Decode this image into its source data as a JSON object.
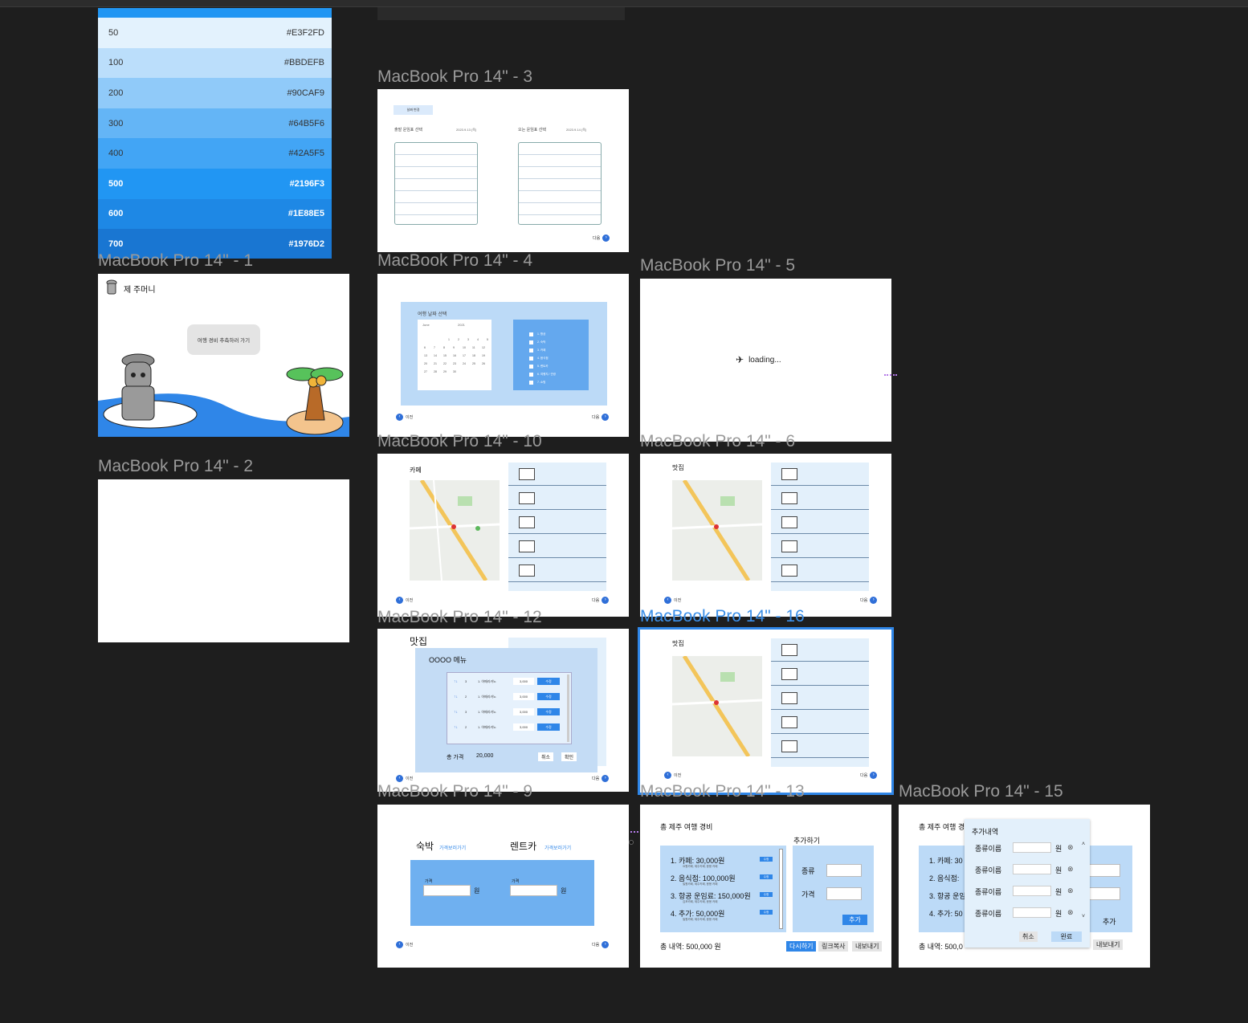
{
  "palette": [
    {
      "shade": "50",
      "hex": "#E3F2FD",
      "bg": "#E3F2FD"
    },
    {
      "shade": "100",
      "hex": "#BBDEFB",
      "bg": "#BBDEFB"
    },
    {
      "shade": "200",
      "hex": "#90CAF9",
      "bg": "#90CAF9"
    },
    {
      "shade": "300",
      "hex": "#64B5F6",
      "bg": "#64B5F6"
    },
    {
      "shade": "400",
      "hex": "#42A5F5",
      "bg": "#42A5F5"
    },
    {
      "shade": "500",
      "hex": "#2196F3",
      "bg": "#2196F3"
    },
    {
      "shade": "600",
      "hex": "#1E88E5",
      "bg": "#1E88E5"
    },
    {
      "shade": "700",
      "hex": "#1976D2",
      "bg": "#1976D2"
    }
  ],
  "frames": {
    "f1": {
      "label": "MacBook Pro 14\" - 1",
      "brand": "제 주머니",
      "cta": "여행 경비 추측하러 가기"
    },
    "f2": {
      "label": "MacBook Pro 14\" - 2"
    },
    "f3": {
      "label": "MacBook Pro 14\" - 3",
      "tab": "날짜 변경",
      "dep": "출발 운임표 선택",
      "dep_date": "2023.9.13 (목)",
      "ret": "오는 운임표 선택",
      "ret_date": "2023.9.14 (목)",
      "next": "다음"
    },
    "f4": {
      "label": "MacBook Pro 14\" - 4",
      "title": "여행 날짜 선택",
      "month": "June",
      "year": "2021",
      "prev": "이전",
      "next": "다음",
      "checks": [
        "1. 항공",
        "2. 숙박",
        "3. 카페",
        "4. 음식점",
        "5. 렌트카",
        "6. 여행지 / 관광",
        "7. 쇼핑"
      ]
    },
    "f5": {
      "label": "MacBook Pro 14\" - 5",
      "loading": "loading..."
    },
    "f10": {
      "label": "MacBook Pro 14\" - 10",
      "title": "카페",
      "prev": "이전",
      "next": "다음"
    },
    "f6": {
      "label": "MacBook Pro 14\" - 6",
      "title": "맛집",
      "prev": "이전",
      "next": "다음"
    },
    "f12": {
      "label": "MacBook Pro 14\" - 12",
      "title": "맛집",
      "modal_title": "OOOO 메뉴",
      "total_label": "총 가격",
      "total": "20,000",
      "cancel": "취소",
      "ok": "확인",
      "prev": "이전",
      "next": "다음",
      "rows": [
        {
          "qty": "3",
          "name": "1. 아메리카노",
          "price": "3,000",
          "btn": "수정"
        },
        {
          "qty": "2",
          "name": "1. 아메리카노",
          "price": "3,000",
          "btn": "수정"
        },
        {
          "qty": "3",
          "name": "1. 아메리카노",
          "price": "3,000",
          "btn": "수정"
        },
        {
          "qty": "2",
          "name": "1. 아메리카노",
          "price": "3,000",
          "btn": "수정"
        }
      ]
    },
    "f16": {
      "label": "MacBook Pro 14\" - 16",
      "title": "맛집",
      "prev": "이전",
      "next": "다음"
    },
    "f9": {
      "label": "MacBook Pro 14\" - 9",
      "stay": "숙박",
      "stay_link": "가격보러가기",
      "car": "렌트카",
      "car_link": "가격보러가기",
      "price": "가격",
      "won": "원",
      "prev": "이전",
      "next": "다음"
    },
    "f13": {
      "label": "MacBook Pro 14\" - 13",
      "title": "총 제주 여행 경비",
      "add_title": "추가하기",
      "items": [
        {
          "t": "1. 카페: 30,000원",
          "s": "요원카페, 제주카페, 응용 카페"
        },
        {
          "t": "2. 음식점: 100,000원",
          "s": "밀원카페, 제주카페, 응용 카페"
        },
        {
          "t": "3. 항공 운임료: 150,000원",
          "s": "김포카페, 제주카페, 응용 카페"
        },
        {
          "t": "4. 추가: 50,000원",
          "s": "밀원카페, 제주카페, 응용 카페"
        }
      ],
      "edit": "수정",
      "kind": "종류",
      "price": "가격",
      "add": "추가",
      "total": "총 내역: 500,000 원",
      "redo": "다시하기",
      "copy": "링크복사",
      "export": "내보내기"
    },
    "f15": {
      "label": "MacBook Pro 14\" - 15",
      "title": "총 제주 여행 경비",
      "popup_title": "추가내역",
      "row_label": "종류이름",
      "won": "원",
      "cancel": "취소",
      "done": "완료",
      "add": "추가",
      "export": "내보내기",
      "total": "총 내역: 500,0",
      "items": [
        "1. 카페: 30",
        "2. 음식점:",
        "3. 항공 운임",
        "4. 추가: 50"
      ]
    }
  }
}
